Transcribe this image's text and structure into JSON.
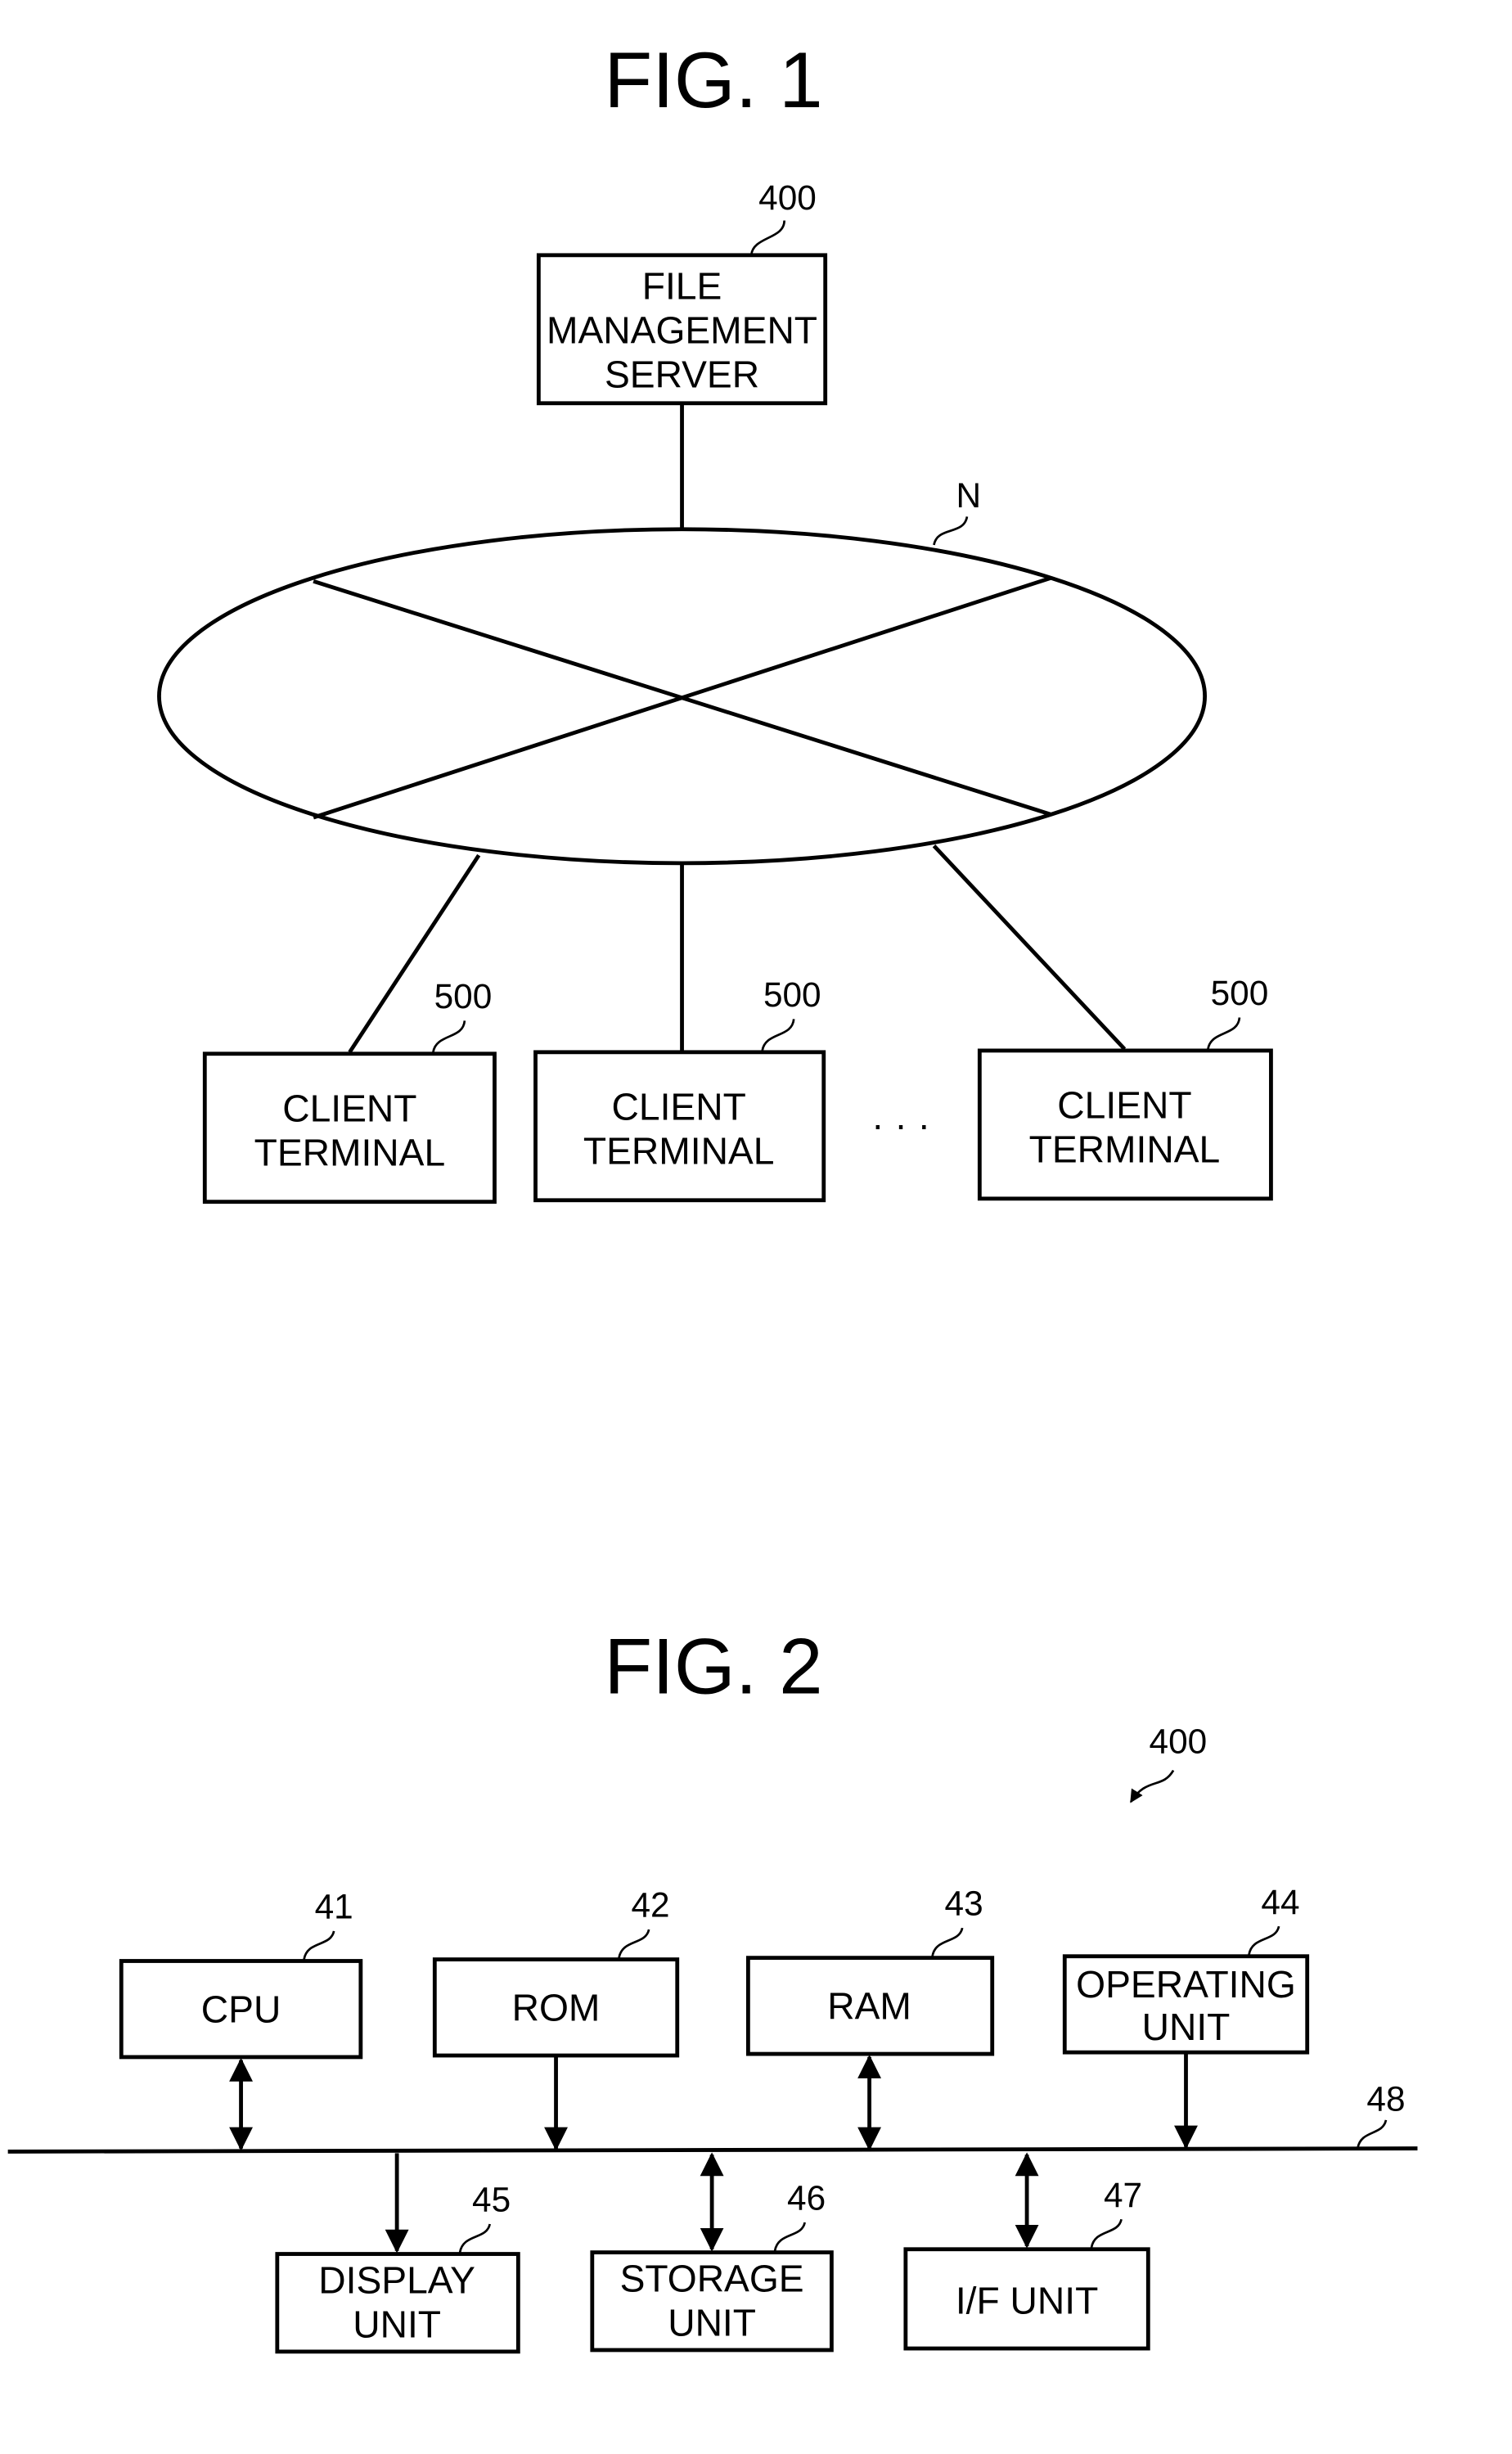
{
  "fig1": {
    "title": "FIG. 1",
    "server": {
      "lines": [
        "FILE",
        "MANAGEMENT",
        "SERVER"
      ],
      "ref": "400"
    },
    "network": {
      "ref": "N"
    },
    "clients": [
      {
        "lines": [
          "CLIENT",
          "TERMINAL"
        ],
        "ref": "500"
      },
      {
        "lines": [
          "CLIENT",
          "TERMINAL"
        ],
        "ref": "500"
      },
      {
        "lines": [
          "CLIENT",
          "TERMINAL"
        ],
        "ref": "500"
      }
    ],
    "ellipsis": "· · ·"
  },
  "fig2": {
    "title": "FIG. 2",
    "ref": "400",
    "bus_ref": "48",
    "top_units": [
      {
        "lines": [
          "CPU"
        ],
        "ref": "41",
        "arrow": "bidirectional"
      },
      {
        "lines": [
          "ROM"
        ],
        "ref": "42",
        "arrow": "to-bus"
      },
      {
        "lines": [
          "RAM"
        ],
        "ref": "43",
        "arrow": "bidirectional"
      },
      {
        "lines": [
          "OPERATING",
          "UNIT"
        ],
        "ref": "44",
        "arrow": "to-bus"
      }
    ],
    "bottom_units": [
      {
        "lines": [
          "DISPLAY",
          "UNIT"
        ],
        "ref": "45",
        "arrow": "from-bus"
      },
      {
        "lines": [
          "STORAGE",
          "UNIT"
        ],
        "ref": "46",
        "arrow": "bidirectional"
      },
      {
        "lines": [
          "I/F UNIT"
        ],
        "ref": "47",
        "arrow": "bidirectional"
      }
    ]
  }
}
